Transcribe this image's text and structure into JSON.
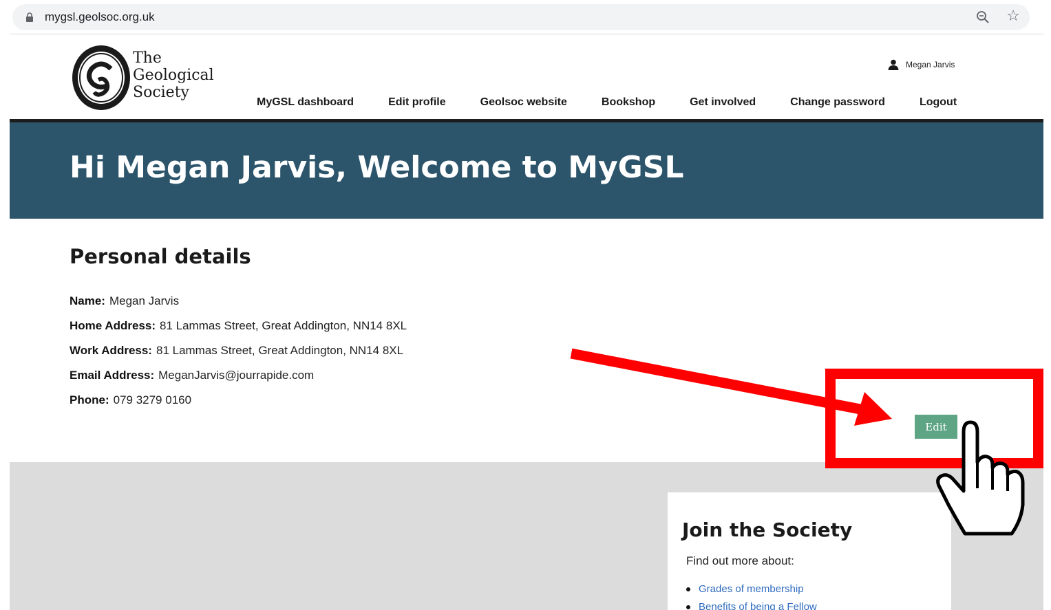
{
  "browser": {
    "url": "mygsl.geolsoc.org.uk",
    "lock_icon": "lock-icon",
    "zoom_icon": "zoom-out-icon",
    "star_icon": "bookmark-star-icon"
  },
  "header": {
    "logo_lines": [
      "The",
      "Geological",
      "Society"
    ],
    "user_name": "Megan Jarvis",
    "user_icon": "user-icon",
    "nav": [
      {
        "label": "MyGSL dashboard"
      },
      {
        "label": "Edit profile"
      },
      {
        "label": "Geolsoc website"
      },
      {
        "label": "Bookshop"
      },
      {
        "label": "Get involved"
      },
      {
        "label": "Change password"
      },
      {
        "label": "Logout"
      }
    ]
  },
  "hero": {
    "title": "Hi Megan Jarvis, Welcome to MyGSL"
  },
  "personal": {
    "title": "Personal details",
    "rows": [
      {
        "label": "Name:",
        "value": "Megan Jarvis"
      },
      {
        "label": "Home Address:",
        "value": "81 Lammas Street, Great Addington, NN14 8XL"
      },
      {
        "label": "Work Address:",
        "value": "81 Lammas Street, Great Addington, NN14 8XL"
      },
      {
        "label": "Email Address:",
        "value": "MeganJarvis@jourrapide.com"
      },
      {
        "label": "Phone:",
        "value": "079 3279 0160"
      }
    ],
    "edit_label": "Edit"
  },
  "join": {
    "title": "Join the Society",
    "subtitle": "Find out more about:",
    "links": [
      {
        "label": "Grades of membership"
      },
      {
        "label": "Benefits of being a Fellow"
      }
    ]
  },
  "colors": {
    "hero_bg": "#2c556c",
    "edit_button": "#5ea585",
    "annotation": "#ff0000",
    "link": "#2f6bbf"
  }
}
